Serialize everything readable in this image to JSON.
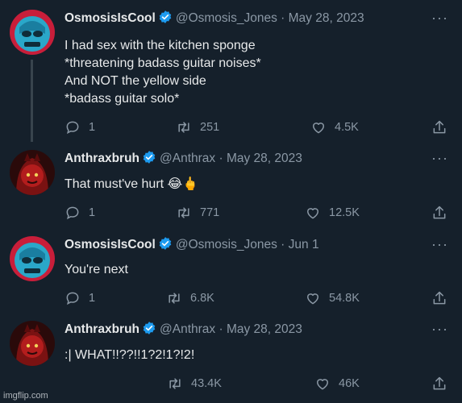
{
  "tweets": [
    {
      "name": "OsmosisIsCool",
      "handle": "@Osmosis_Jones",
      "sep": "·",
      "date": "May 28, 2023",
      "lines": [
        "I had sex with the kitchen sponge",
        "*threatening badass guitar noises*",
        "And NOT the yellow side",
        "*badass guitar solo*"
      ],
      "replies": "1",
      "retweets": "251",
      "likes": "4.5K",
      "avatar": "blue-masked-face"
    },
    {
      "name": "Anthraxbruh",
      "handle": "@Anthrax",
      "sep": "·",
      "date": "May 28, 2023",
      "lines": [
        "That must've hurt 😂🖕"
      ],
      "replies": "1",
      "retweets": "771",
      "likes": "12.5K",
      "avatar": "red-hooded-face"
    },
    {
      "name": "OsmosisIsCool",
      "handle": "@Osmosis_Jones",
      "sep": "·",
      "date": "Jun 1",
      "lines": [
        "You're next"
      ],
      "replies": "1",
      "retweets": "6.8K",
      "likes": "54.8K",
      "avatar": "blue-masked-face"
    },
    {
      "name": "Anthraxbruh",
      "handle": "@Anthrax",
      "sep": "·",
      "date": "May 28, 2023",
      "lines": [
        ":| WHAT!!??!!1?2!1?!2!"
      ],
      "replies": "",
      "retweets": "43.4K",
      "likes": "46K",
      "avatar": "red-hooded-face"
    }
  ],
  "icons": {
    "more": "more-dots-icon",
    "verified": "verified-badge-icon",
    "reply": "reply-icon",
    "retweet": "retweet-icon",
    "like": "heart-icon",
    "share": "share-icon"
  },
  "colors": {
    "background": "#15202b",
    "muted": "#8b98a5",
    "verified": "#1d9bf0",
    "thread_line": "#38444d"
  },
  "watermark": "imgflip.com"
}
